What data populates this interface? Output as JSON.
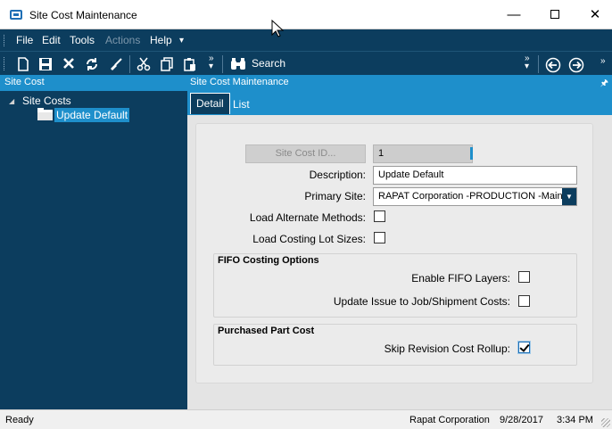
{
  "window": {
    "title": "Site Cost Maintenance",
    "controls": {
      "minimize": "—",
      "close": "✕"
    }
  },
  "menubar": {
    "items": [
      {
        "label": "File",
        "enabled": true
      },
      {
        "label": "Edit",
        "enabled": true
      },
      {
        "label": "Tools",
        "enabled": true
      },
      {
        "label": "Actions",
        "enabled": false
      },
      {
        "label": "Help",
        "enabled": true
      }
    ],
    "overflow_glyph": "▾"
  },
  "toolbar": {
    "buttons": [
      "new-icon",
      "save-icon",
      "delete-icon",
      "refresh-icon",
      "clear-icon",
      "cut-icon",
      "copy-icon",
      "paste-icon",
      "search-icon",
      "back-icon",
      "forward-icon"
    ],
    "search_label": "Search",
    "overflow_glyph": "»"
  },
  "left_pane": {
    "header": "Site Cost",
    "tree": {
      "root": "Site Costs",
      "selected_child": "Update Default"
    }
  },
  "right_pane": {
    "header": "Site Cost Maintenance",
    "tabs": [
      {
        "label": "Detail",
        "active": true
      },
      {
        "label": "List",
        "active": false
      }
    ]
  },
  "form": {
    "site_cost_id": {
      "button_label": "Site Cost ID...",
      "value": "1"
    },
    "description": {
      "label": "Description:",
      "value": "Update Default"
    },
    "primary_site": {
      "label": "Primary Site:",
      "value": "RAPAT Corporation -PRODUCTION -Main"
    },
    "load_alternate_methods": {
      "label": "Load Alternate Methods:",
      "checked": false
    },
    "load_costing_lot_sizes": {
      "label": "Load Costing Lot Sizes:",
      "checked": false
    },
    "fifo_group": {
      "title": "FIFO Costing Options",
      "enable_fifo_layers": {
        "label": "Enable FIFO Layers:",
        "checked": false
      },
      "update_issue": {
        "label": "Update Issue to Job/Shipment Costs:",
        "checked": false
      }
    },
    "purchased_group": {
      "title": "Purchased Part Cost",
      "skip_revision": {
        "label": "Skip Revision Cost Rollup:",
        "checked": true
      }
    }
  },
  "statusbar": {
    "status": "Ready",
    "company": "Rapat Corporation",
    "date": "9/28/2017",
    "time": "3:34 PM"
  },
  "colors": {
    "navy": "#0c3d5e",
    "accent_blue": "#1e8fcb",
    "form_bg": "#ebebeb"
  }
}
